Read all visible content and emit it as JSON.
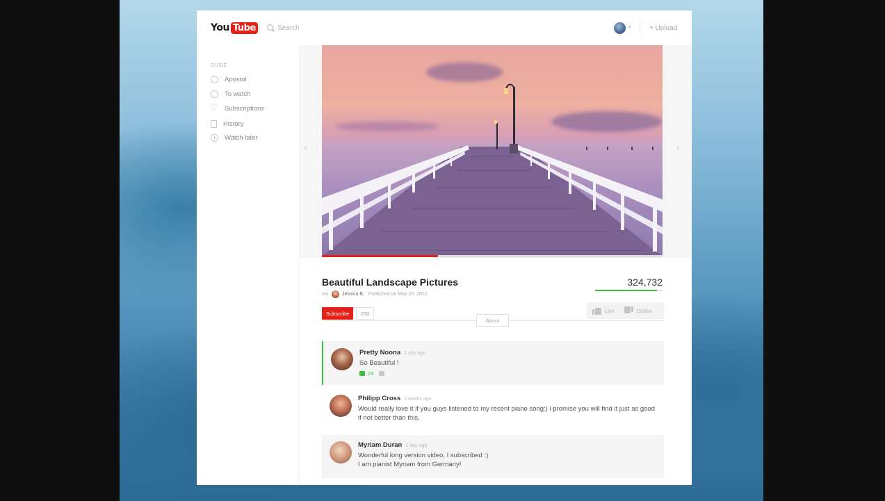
{
  "header": {
    "logo_you": "You",
    "logo_tube": "Tube",
    "search_placeholder": "Search",
    "upload_label": "Upload"
  },
  "sidebar": {
    "guide_label": "GUIDE",
    "items": [
      {
        "label": "Apostol",
        "icon": "user-icon"
      },
      {
        "label": "To watch",
        "icon": "globe-icon"
      },
      {
        "label": "Subscriptions",
        "icon": "heart-icon"
      },
      {
        "label": "History",
        "icon": "document-icon"
      },
      {
        "label": "Watch later",
        "icon": "clock-icon"
      }
    ]
  },
  "video": {
    "title": "Beautiful Landscape Pictures",
    "via": "via",
    "author": "Jessica B.",
    "published": "Published on May 26, 2012",
    "views": "324,732",
    "views_bar_fraction": 0.92,
    "progress_fraction": 0.34,
    "subscribe_label": "Subscribe",
    "subscriber_count": "230",
    "like_label": "Like",
    "dislike_label": "Dislike",
    "about_label": "About"
  },
  "comments": [
    {
      "name": "Pretty Noona",
      "time": "1 day ago",
      "text": "So Beautiful !",
      "likes": "24"
    },
    {
      "name": "Philipp Cross",
      "time": "3 weeks ago",
      "text": "Would really love it if you guys listened to my recent piano song:) i promise you will find it just as good if not better than this."
    },
    {
      "name": "Myriam Duran",
      "time": "1 day ago",
      "text_line1": "Wonderful long version video, I subscribed :)",
      "text_line2": "I am pianist Myriam from Germany!"
    }
  ],
  "colors": {
    "accent_red": "#e62117",
    "accent_green": "#3fbf3f"
  }
}
